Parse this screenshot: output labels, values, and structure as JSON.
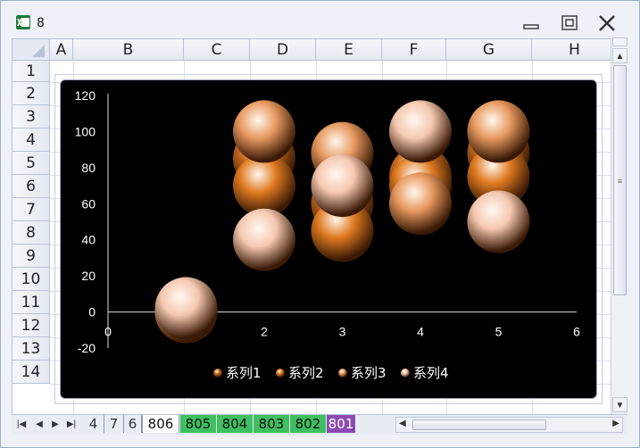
{
  "window": {
    "title": "8"
  },
  "columns": [
    "A",
    "B",
    "C",
    "D",
    "E",
    "F",
    "G",
    "H"
  ],
  "rows": [
    "1",
    "2",
    "3",
    "4",
    "5",
    "6",
    "7",
    "8",
    "9",
    "10",
    "11",
    "12",
    "13",
    "14"
  ],
  "sheet_tabs": [
    {
      "label": "4",
      "style": "plain"
    },
    {
      "label": "7",
      "style": "plain"
    },
    {
      "label": "6",
      "style": "plain"
    },
    {
      "label": "806",
      "style": "active"
    },
    {
      "label": "805",
      "style": "green"
    },
    {
      "label": "804",
      "style": "green"
    },
    {
      "label": "803",
      "style": "green"
    },
    {
      "label": "802",
      "style": "green"
    },
    {
      "label": "801",
      "style": "purple"
    }
  ],
  "chart_data": {
    "type": "bubble",
    "x_ticks": [
      "0",
      "1",
      "2",
      "3",
      "4",
      "5",
      "6"
    ],
    "y_ticks": [
      "120",
      "100",
      "80",
      "60",
      "40",
      "20",
      "0",
      "-20"
    ],
    "xlim": [
      0,
      6
    ],
    "ylim": [
      -20,
      120
    ],
    "legend_position": "bottom",
    "series": [
      {
        "name": "系列1",
        "color": "#c86a1c",
        "x": [
          1,
          2,
          3,
          4,
          5
        ],
        "y": [
          0,
          85,
          60,
          75,
          88
        ]
      },
      {
        "name": "系列2",
        "color": "#e07a20",
        "x": [
          1,
          2,
          3,
          4,
          5
        ],
        "y": [
          0,
          70,
          45,
          70,
          75
        ]
      },
      {
        "name": "系列3",
        "color": "#e89a60",
        "x": [
          1,
          2,
          3,
          4,
          5
        ],
        "y": [
          0,
          100,
          88,
          60,
          100
        ]
      },
      {
        "name": "系列4",
        "color": "#f5c8b0",
        "x": [
          1,
          2,
          3,
          4,
          5
        ],
        "y": [
          2,
          40,
          70,
          100,
          50
        ]
      }
    ]
  }
}
